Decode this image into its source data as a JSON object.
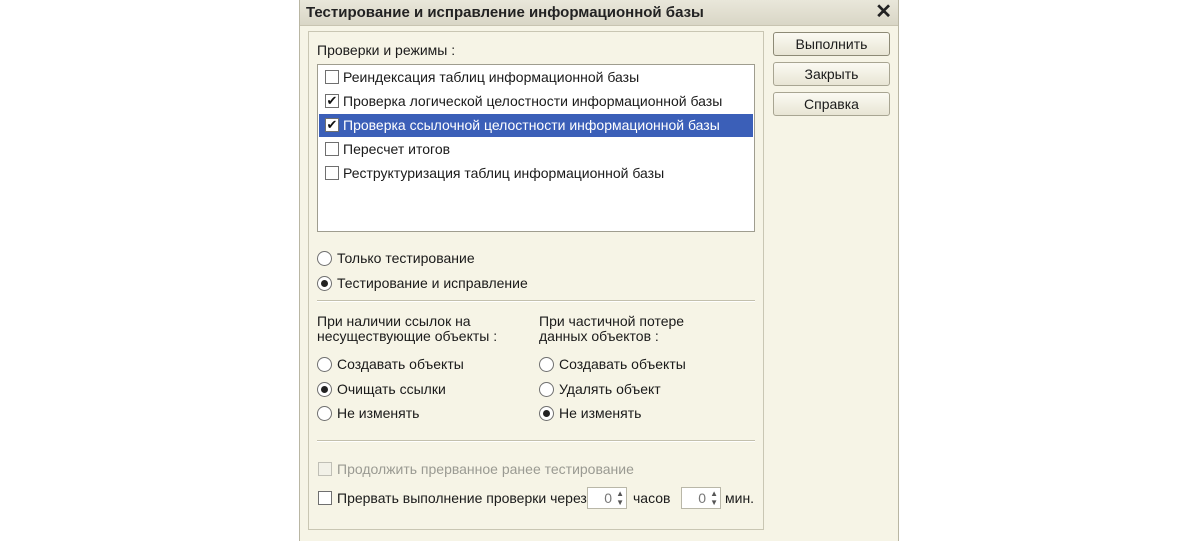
{
  "window": {
    "title": "Тестирование и исправление информационной базы",
    "close": "✕"
  },
  "checks": {
    "label": "Проверки и режимы :",
    "items": [
      {
        "label": "Реиндексация таблиц информационной базы",
        "checked": false,
        "selected": false
      },
      {
        "label": "Проверка логической целостности информационной базы",
        "checked": true,
        "selected": false
      },
      {
        "label": "Проверка ссылочной целостности информационной базы",
        "checked": true,
        "selected": true
      },
      {
        "label": "Пересчет итогов",
        "checked": false,
        "selected": false
      },
      {
        "label": "Реструктуризация таблиц информационной базы",
        "checked": false,
        "selected": false
      }
    ]
  },
  "mode": {
    "options": [
      {
        "label": "Только тестирование",
        "selected": false
      },
      {
        "label": "Тестирование и исправление",
        "selected": true
      }
    ]
  },
  "refs": {
    "heading_line1": "При наличии ссылок на",
    "heading_line2": "несуществующие объекты :",
    "options": [
      {
        "label": "Создавать объекты",
        "selected": false
      },
      {
        "label": "Очищать ссылки",
        "selected": true
      },
      {
        "label": "Не изменять",
        "selected": false
      }
    ]
  },
  "loss": {
    "heading_line1": "При частичной потере",
    "heading_line2": "данных объектов :",
    "options": [
      {
        "label": "Создавать объекты",
        "selected": false
      },
      {
        "label": "Удалять объект",
        "selected": false
      },
      {
        "label": "Не изменять",
        "selected": true
      }
    ]
  },
  "continue_testing": {
    "label": "Продолжить прерванное ранее тестирование",
    "checked": false,
    "enabled": false
  },
  "interrupt": {
    "label": "Прервать выполнение проверки через",
    "checked": false,
    "hours_value": "0",
    "hours_label": "часов",
    "minutes_value": "0",
    "minutes_label": "мин."
  },
  "buttons": {
    "run": "Выполнить",
    "close": "Закрыть",
    "help": "Справка"
  },
  "colors": {
    "selection": "#3b5fb8",
    "dialog_bg": "#f6f4e6"
  }
}
